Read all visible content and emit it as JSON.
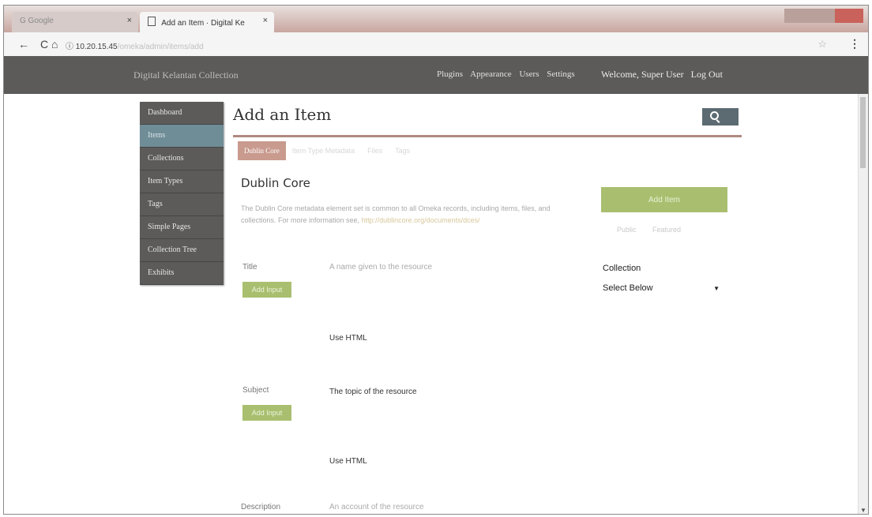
{
  "browser": {
    "tabs": [
      {
        "title": "G Google"
      },
      {
        "title": "Add an Item · Digital Ke"
      }
    ],
    "tab_close": "×",
    "url_ip": "10.20.15.45",
    "url_path": "/omeka/admin/items/add",
    "star": "☆",
    "menu": "⋮"
  },
  "header": {
    "site_title": "Digital Kelantan Collection",
    "nav": [
      "Plugins",
      "Appearance",
      "Users",
      "Settings"
    ],
    "welcome": "Welcome, Super User",
    "logout": "Log Out"
  },
  "sidebar": {
    "items": [
      {
        "label": "Dashboard"
      },
      {
        "label": "Items"
      },
      {
        "label": "Collections"
      },
      {
        "label": "Item Types"
      },
      {
        "label": "Tags"
      },
      {
        "label": "Simple Pages"
      },
      {
        "label": "Collection Tree"
      },
      {
        "label": "Exhibits"
      }
    ],
    "active_index": 1
  },
  "main": {
    "title": "Add an Item",
    "tabs": [
      "Dublin Core",
      "Item Type Metadata",
      "Files",
      "Tags"
    ],
    "section_title": "Dublin Core",
    "description_prefix": "The Dublin Core metadata element set is common to all Omeka records, including items, files, and collections. For more information see, ",
    "description_link": "http://dublincore.org/documents/dces/",
    "fields": [
      {
        "label": "Title",
        "hint": "A name given to the resource",
        "button": "Add Input",
        "use_html": "Use HTML"
      },
      {
        "label": "Subject",
        "hint": "The topic of the resource",
        "button": "Add Input",
        "use_html": "Use HTML"
      },
      {
        "label": "Description",
        "hint": "An account of the resource"
      }
    ]
  },
  "panel": {
    "add_item": "Add Item",
    "public": "Public",
    "featured": "Featured",
    "collection_label": "Collection",
    "collection_value": "Select Below",
    "collection_arrow": "▼"
  },
  "colors": {
    "topbar": "#5c5b5a",
    "accent_green": "#a9bf6f",
    "active_tab": "#c99a8e",
    "sidebar_active": "#6f8d97"
  }
}
